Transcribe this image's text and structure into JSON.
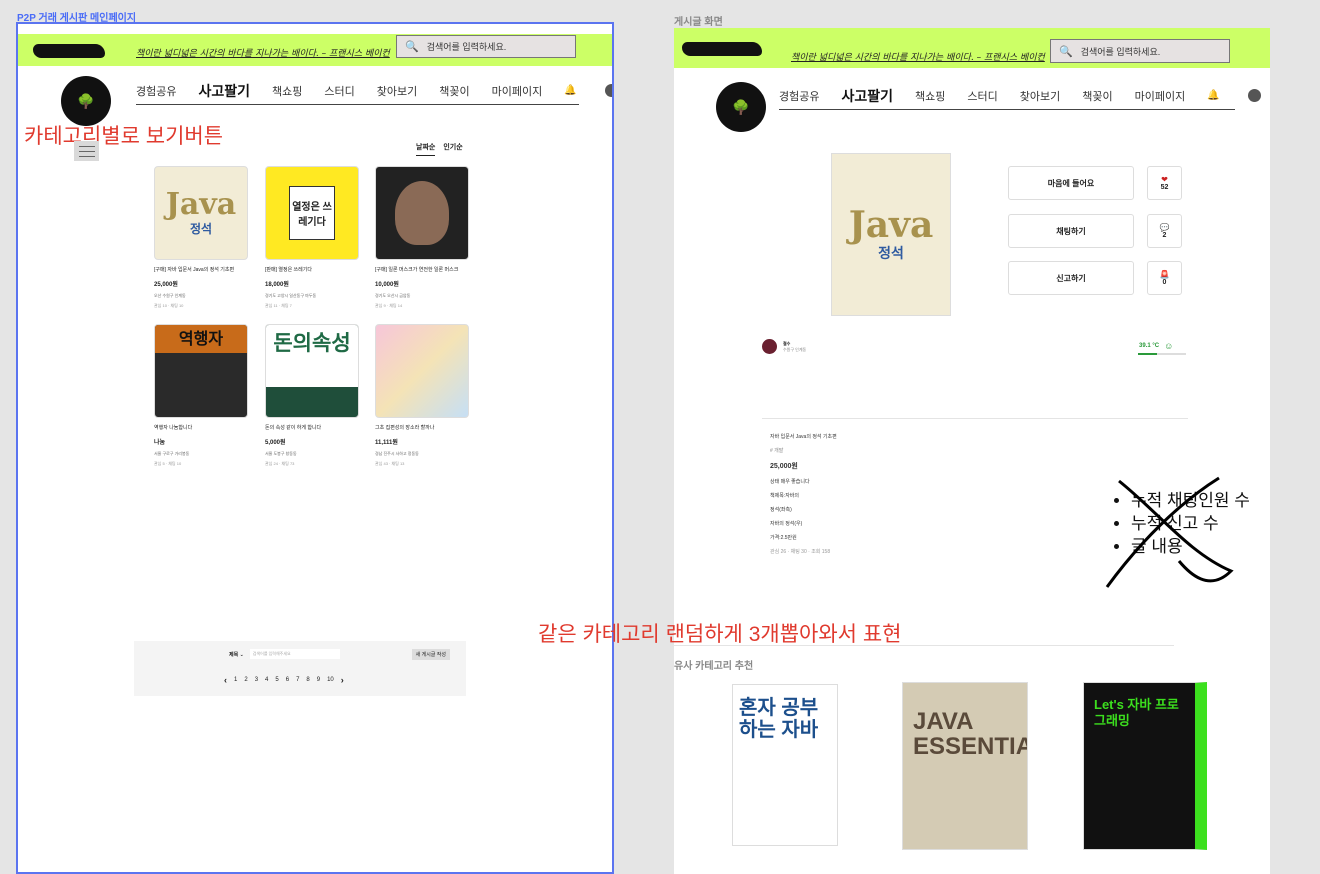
{
  "left_frame": {
    "label": "P2P 거래 게시판 메인페이지",
    "quote": "책이란 넓디넓은 시간의 바다를 지나가는 배이다. – 프랜시스 베이컨",
    "search_placeholder": "검색어를 입력하세요.",
    "nav": [
      "경험공유",
      "사고팔기",
      "책쇼핑",
      "스터디",
      "찾아보기",
      "책꽂이",
      "마이페이지"
    ],
    "annotation": "카테고리별로 보기버튼",
    "sort": [
      "날짜순",
      "인기순"
    ],
    "posts": [
      {
        "title": "[구매] 자바 입문서 Java의 정석 기초편",
        "price": "25,000원",
        "loc": "오산 수원구 인계동",
        "meta": "관심 10 · 채팅 10"
      },
      {
        "title": "[판매] 열정은 쓰레기다",
        "price": "18,000원",
        "loc": "경기도 고양시 일산동구 마두동",
        "meta": "관심 11 · 채팅 7"
      },
      {
        "title": "[구매] 일론 머스크가 연전한 일론 머스크",
        "price": "10,000원",
        "loc": "경기도 오산시 금암동",
        "meta": "관심 9 · 채팅 14"
      },
      {
        "title": "역행자 나눔합니다",
        "price": "나눔",
        "loc": "서울 구로구 가리봉동",
        "meta": "관심 5 · 채팅 10"
      },
      {
        "title": "돈의 속성 같이 하게 합니다",
        "price": "5,000원",
        "loc": "서울 도봉구 창동동",
        "meta": "관심 24 · 채팅 73"
      },
      {
        "title": "그초 집편성의 장소라 할까나",
        "price": "11,111원",
        "loc": "경남 진주시 사하고 정동동",
        "meta": "관심 43 · 채팅 13"
      }
    ],
    "covers": [
      {
        "big": "Java",
        "sub": "정석"
      },
      {
        "text": "열정은 쓰레기다"
      },
      {
        "text": ""
      },
      {
        "text": "역행자"
      },
      {
        "text": "돈의속성"
      },
      {
        "text": ""
      }
    ],
    "pager": {
      "select": "제목",
      "input_placeholder": "검색어를 입력해주세요",
      "new_post": "새 게시글 작성",
      "pages": [
        "1",
        "2",
        "3",
        "4",
        "5",
        "6",
        "7",
        "8",
        "9",
        "10"
      ]
    }
  },
  "right_frame": {
    "label": "게시글 화면",
    "quote": "책이란 넓디넓은 시간의 바다를 지나가는 배이다. – 프랜시스 베이컨",
    "search_placeholder": "검색어를 입력하세요.",
    "nav": [
      "경험공유",
      "사고팔기",
      "책쇼핑",
      "스터디",
      "찾아보기",
      "책꽂이",
      "마이페이지"
    ],
    "cover": {
      "big": "Java",
      "sub": "정석"
    },
    "actions": [
      "마음에 들어요",
      "채팅하기",
      "신고하기"
    ],
    "counts": [
      {
        "icon": "heart-icon",
        "value": "52"
      },
      {
        "icon": "chat-icon",
        "value": "2"
      },
      {
        "icon": "siren-icon",
        "value": "0"
      }
    ],
    "seller": {
      "name": "철수",
      "sub": "수원구 인계동"
    },
    "temperature": {
      "value": "39.1 °C",
      "level": 0.39
    },
    "post": {
      "title": "자바 입문서 Java의 정석 기초편",
      "category": "# 개발",
      "price": "25,000원",
      "description": "상태 매우 좋습니다",
      "lines": [
        "책제목:자바의",
        "정석(좌측)",
        "자바의 정석(우)",
        "가격:2.5만원"
      ],
      "meta": "관심 26 · 채팅 30 · 조회 158"
    },
    "bullets": [
      "누적 채팅인원 수",
      "누적 신고 수",
      "글 내용"
    ],
    "annotation": "같은 카테고리 랜덤하게 3개뽑아와서 표현",
    "rec_title": "유사 카테고리 추천",
    "recs": [
      {
        "text": "혼자 공부하는 자바"
      },
      {
        "text": "JAVA ESSENTIAL"
      },
      {
        "text": "Let's 자바 프로그래밍"
      }
    ]
  }
}
